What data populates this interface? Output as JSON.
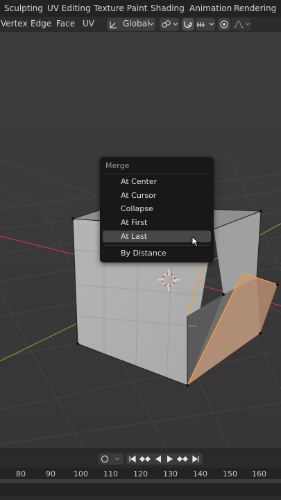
{
  "workspace_tabs": [
    "Sculpting",
    "UV Editing",
    "Texture Paint",
    "Shading",
    "Animation",
    "Rendering"
  ],
  "header_menus": [
    "Vertex",
    "Edge",
    "Face",
    "UV"
  ],
  "transform_orientation": "Global",
  "merge_menu": {
    "title": "Merge",
    "items": [
      "At Center",
      "At Cursor",
      "Collapse",
      "At First",
      "At Last",
      "By Distance"
    ],
    "highlighted": "At Last"
  },
  "timeline": {
    "frames": [
      "80",
      "90",
      "100",
      "110",
      "120",
      "130",
      "140",
      "150",
      "160"
    ]
  },
  "icons": {
    "orientation": "axes-icon",
    "pivot": "link-icon",
    "snap": "magnet-icon",
    "snap_target": "increment-icon",
    "proportional": "proportional-edit-icon",
    "falloff": "falloff-curve-icon",
    "cursor": "mouse-pointer-icon",
    "record": "record-icon"
  },
  "colors": {
    "selection_orange": "#ff9a2e",
    "x_axis": "#b8384a",
    "y_axis": "#6b9a2a",
    "highlight": "#474747"
  }
}
